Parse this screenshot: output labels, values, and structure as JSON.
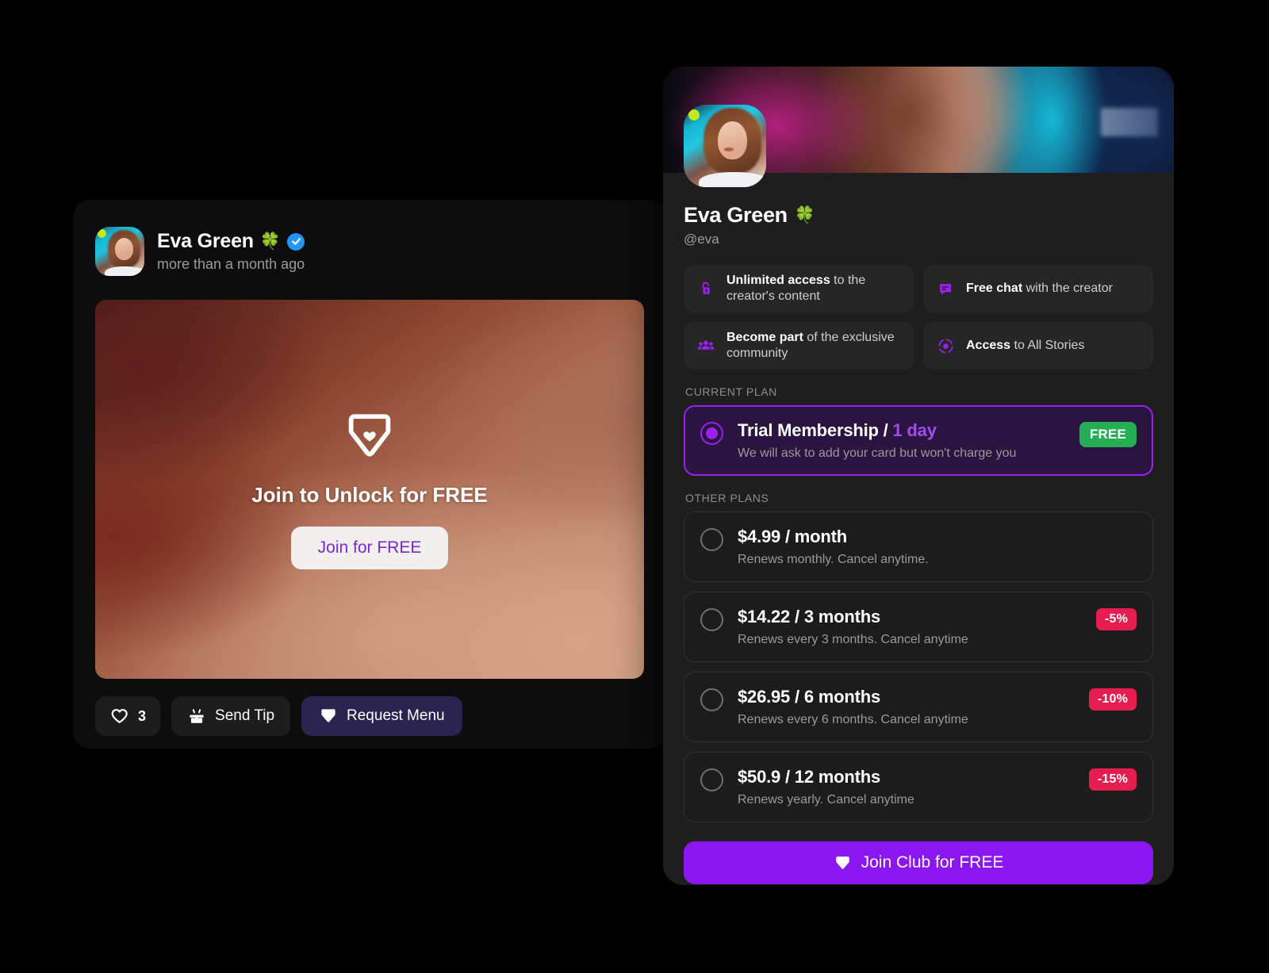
{
  "post": {
    "author_name": "Eva Green",
    "author_emoji": "🍀",
    "timestamp": "more than a month ago",
    "locked": {
      "title": "Join to Unlock for FREE",
      "cta_label": "Join for FREE"
    },
    "actions": {
      "like_count": "3",
      "send_tip_label": "Send Tip",
      "request_menu_label": "Request Menu"
    }
  },
  "subscription": {
    "creator_name": "Eva Green",
    "creator_emoji": "🍀",
    "handle": "@eva",
    "benefits": [
      {
        "icon": "unlock-icon",
        "strong": "Unlimited access",
        "rest": " to the creator's content"
      },
      {
        "icon": "chat-icon",
        "strong": "Free chat",
        "rest": " with the creator"
      },
      {
        "icon": "people-icon",
        "strong": "Become part",
        "rest": " of the exclusive community"
      },
      {
        "icon": "stories-icon",
        "strong": "Access",
        "rest": " to All Stories"
      }
    ],
    "current_plan_label": "CURRENT PLAN",
    "other_plans_label": "OTHER PLANS",
    "current_plan": {
      "title": "Trial Membership / ",
      "title_accent": "1 day",
      "subtitle": "We will ask to add your card but won't charge you",
      "badge": "FREE",
      "selected": true
    },
    "other_plans": [
      {
        "title": "$4.99 / month",
        "subtitle": "Renews monthly. Cancel anytime.",
        "badge": ""
      },
      {
        "title": "$14.22 / 3 months",
        "subtitle": "Renews every 3 months. Cancel anytime",
        "badge": "-5%"
      },
      {
        "title": "$26.95 / 6 months",
        "subtitle": "Renews every 6 months. Cancel anytime",
        "badge": "-10%"
      },
      {
        "title": "$50.9 / 12 months",
        "subtitle": "Renews yearly. Cancel anytime",
        "badge": "-15%"
      }
    ],
    "cta_label": "Join Club for FREE"
  },
  "colors": {
    "accent_purple": "#8b16f2",
    "accent_purple_light": "#a24bf0",
    "badge_free_green": "#25ae54",
    "badge_discount_pink": "#e61d4f",
    "panel_bg": "#1e1e1e",
    "card_bg": "#1c1c1c",
    "current_plan_bg": "#2a1440",
    "verified_blue": "#2196f3",
    "online_green": "#c3e81d"
  }
}
